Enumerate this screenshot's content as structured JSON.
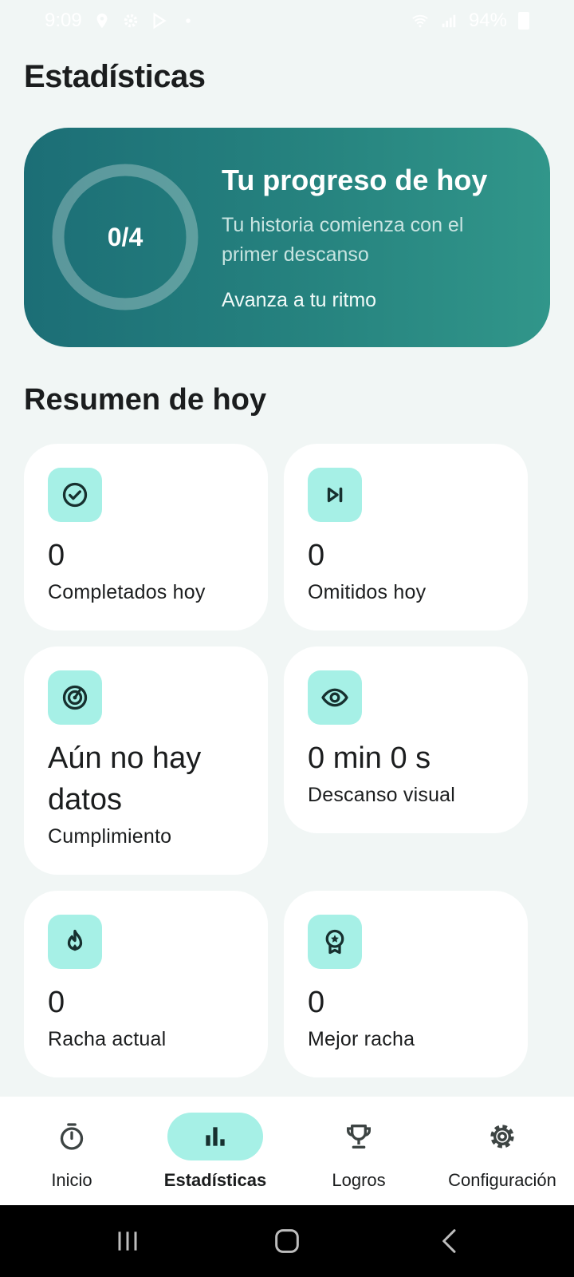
{
  "status_bar": {
    "time": "9:09",
    "battery": "94%",
    "icons": [
      "location-icon",
      "settings-icon",
      "play-store-icon",
      "dot-icon",
      "wifi-icon",
      "signal-icon",
      "battery-icon"
    ]
  },
  "page": {
    "title": "Estadísticas"
  },
  "progress": {
    "ring_label": "0/4",
    "completed": 0,
    "goal": 4,
    "title": "Tu progreso de hoy",
    "subtitle": "Tu historia comienza con el primer descanso",
    "pace": "Avanza a tu ritmo"
  },
  "summary": {
    "title": "Resumen de hoy",
    "cards": [
      {
        "icon": "check-circle-icon",
        "value": "0",
        "label": "Completados hoy"
      },
      {
        "icon": "skip-next-icon",
        "value": "0",
        "label": "Omitidos hoy"
      },
      {
        "icon": "target-icon",
        "value": "Aún no hay datos",
        "label": "Cumplimiento"
      },
      {
        "icon": "eye-icon",
        "value": "0 min 0 s",
        "label": "Descanso visual"
      },
      {
        "icon": "flame-icon",
        "value": "0",
        "label": "Racha actual"
      },
      {
        "icon": "award-icon",
        "value": "0",
        "label": "Mejor racha"
      }
    ]
  },
  "bottom_nav": {
    "items": [
      {
        "label": "Inicio",
        "icon": "timer-icon",
        "active": false
      },
      {
        "label": "Estadísticas",
        "icon": "bar-chart-icon",
        "active": true
      },
      {
        "label": "Logros",
        "icon": "trophy-icon",
        "active": false
      },
      {
        "label": "Configuración",
        "icon": "gear-icon",
        "active": false
      }
    ]
  },
  "colors": {
    "background": "#F1F6F5",
    "hero_start": "#1C6E76",
    "hero_end": "#31968A",
    "icon_badge": "#A6F0E6",
    "text": "#1B1D1E"
  }
}
